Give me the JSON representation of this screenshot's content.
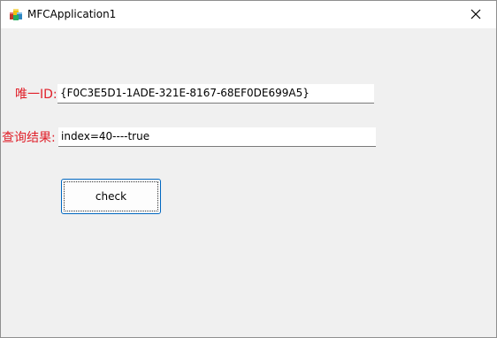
{
  "window": {
    "title": "MFCApplication1",
    "app_icon": "mfc-app-icon",
    "close_icon": "close-icon"
  },
  "form": {
    "id_label": "唯一ID:",
    "id_value": "{F0C3E5D1-1ADE-321E-8167-68EF0DE699A5}",
    "result_label": "查询结果:",
    "result_value": "index=40----true",
    "check_button_label": "check"
  },
  "colors": {
    "label_color": "#e0202a",
    "button_border": "#0067c0",
    "client_background": "#f0f0f0"
  }
}
